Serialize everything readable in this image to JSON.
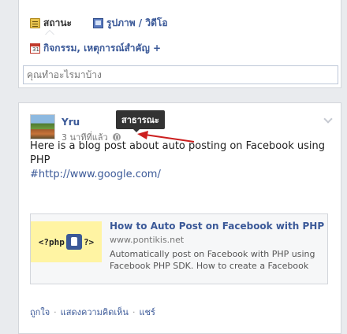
{
  "composer": {
    "tabs": [
      {
        "label": "สถานะ",
        "icon": "status-icon"
      },
      {
        "label": "รูปภาพ / วิดีโอ",
        "icon": "photo-video-icon"
      },
      {
        "label": "กิจกรรม, เหตุการณ์สำคัญ +",
        "icon": "calendar-icon"
      }
    ],
    "calendar_day": "31",
    "input_placeholder": "คุณทำอะไรมาบ้าง"
  },
  "post": {
    "author": "Yru",
    "timestamp": "3 นาทีที่แล้ว",
    "privacy_tooltip": "สาธารณะ",
    "text_line1": "Here is a blog post about auto posting on Facebook using PHP",
    "hashtag": "#http://www.google.com/",
    "link": {
      "title": "How to Auto Post on Facebook with PHP",
      "domain": "www.pontikis.net",
      "description": "Automatically post on Facebook with PHP using Facebook PHP SDK. How to create a Facebook",
      "thumb_left": "<?php",
      "thumb_right": "?>"
    },
    "actions": {
      "like": "ถูกใจ",
      "comment": "แสดงความคิดเห็น",
      "share": "แชร์",
      "separator": "·"
    }
  },
  "colors": {
    "link": "#3b5998",
    "annotation_arrow": "#cc1f1f",
    "tooltip_bg": "#333333"
  }
}
